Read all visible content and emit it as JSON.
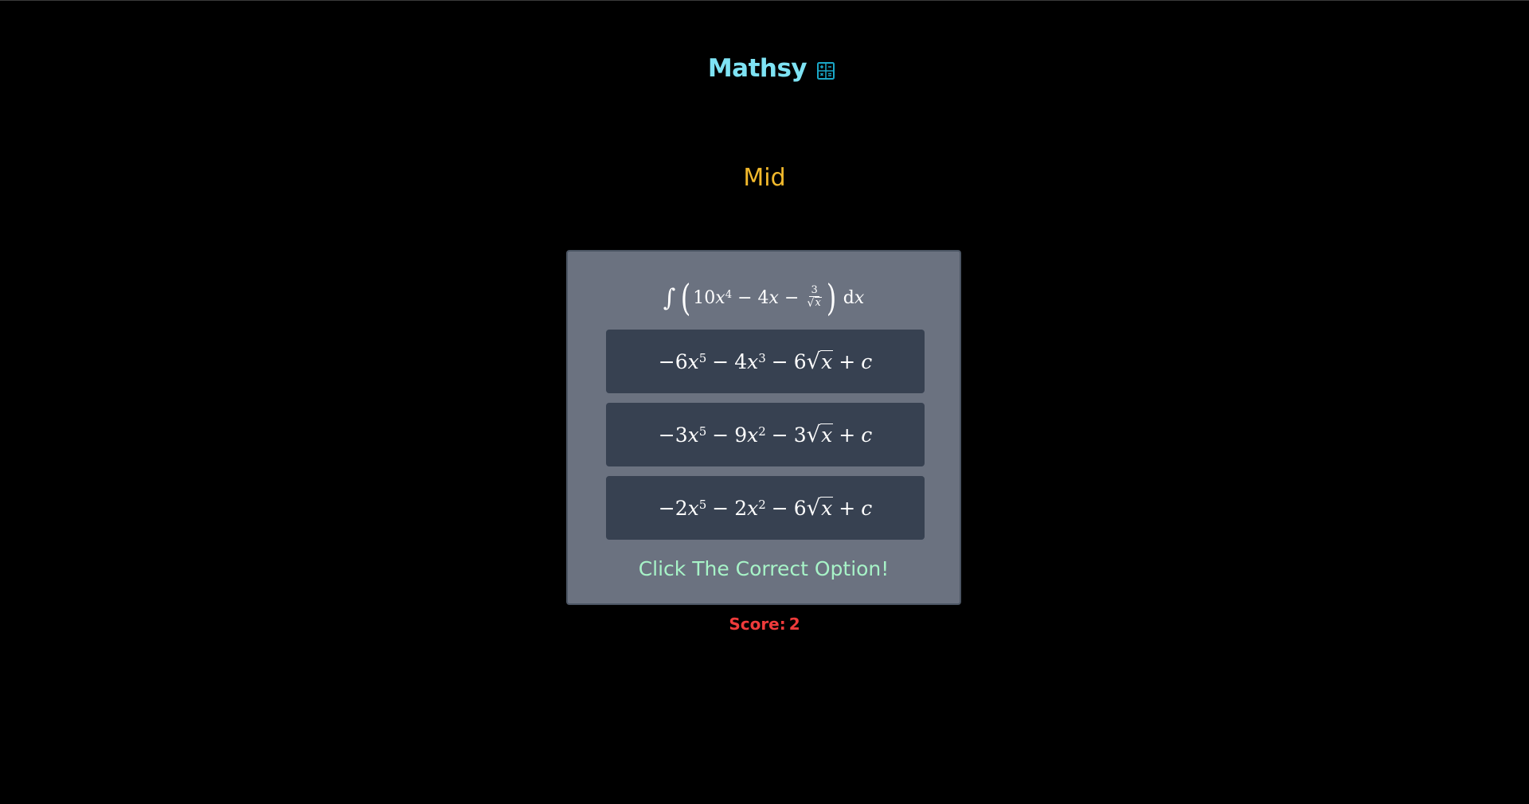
{
  "app": {
    "title": "Mathsy",
    "icon": "calculator-icon",
    "colors": {
      "brand": "#7ee3f4",
      "difficulty": "#f2b92c",
      "card": "#6b7280",
      "option": "#374151",
      "prompt": "#a7f3c7",
      "score": "#ef3b3b"
    }
  },
  "game": {
    "difficulty": "Mid",
    "question": {
      "integral": "∫",
      "open": "(",
      "t1_coef": "10",
      "t1_var": "x",
      "t1_exp": "4",
      "op1": "−",
      "t2_coef": "4",
      "t2_var": "x",
      "op2": "−",
      "frac_num": "3",
      "frac_den_var": "x",
      "close": ")",
      "differential": "d",
      "differential_var": "x"
    },
    "options": [
      {
        "lead": "−6",
        "var1": "x",
        "exp1": "5",
        "op1": "−",
        "coef2": "4",
        "var2": "x",
        "exp2": "3",
        "op2": "−",
        "coef3": "6",
        "rad_var": "x",
        "op3": "+",
        "const": "c"
      },
      {
        "lead": "−3",
        "var1": "x",
        "exp1": "5",
        "op1": "−",
        "coef2": "9",
        "var2": "x",
        "exp2": "2",
        "op2": "−",
        "coef3": "3",
        "rad_var": "x",
        "op3": "+",
        "const": "c"
      },
      {
        "lead": "−2",
        "var1": "x",
        "exp1": "5",
        "op1": "−",
        "coef2": "2",
        "var2": "x",
        "exp2": "2",
        "op2": "−",
        "coef3": "6",
        "rad_var": "x",
        "op3": "+",
        "const": "c"
      }
    ],
    "prompt": "Click The Correct Option!",
    "score_label": "Score:",
    "score_value": "2"
  }
}
